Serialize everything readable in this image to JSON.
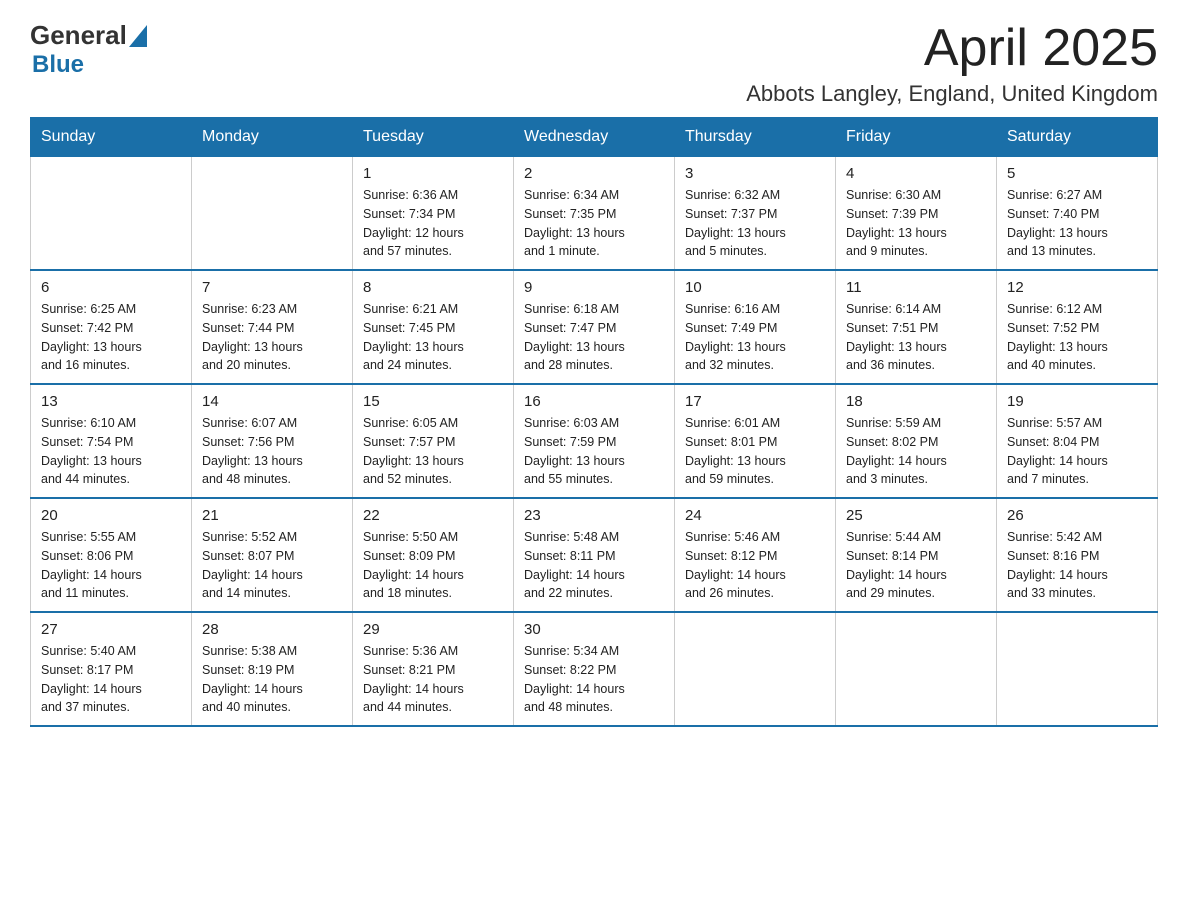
{
  "logo": {
    "text_general": "General",
    "text_blue": "Blue",
    "arrow": "▲"
  },
  "title": "April 2025",
  "location": "Abbots Langley, England, United Kingdom",
  "headers": [
    "Sunday",
    "Monday",
    "Tuesday",
    "Wednesday",
    "Thursday",
    "Friday",
    "Saturday"
  ],
  "weeks": [
    [
      {
        "day": "",
        "info": ""
      },
      {
        "day": "",
        "info": ""
      },
      {
        "day": "1",
        "info": "Sunrise: 6:36 AM\nSunset: 7:34 PM\nDaylight: 12 hours\nand 57 minutes."
      },
      {
        "day": "2",
        "info": "Sunrise: 6:34 AM\nSunset: 7:35 PM\nDaylight: 13 hours\nand 1 minute."
      },
      {
        "day": "3",
        "info": "Sunrise: 6:32 AM\nSunset: 7:37 PM\nDaylight: 13 hours\nand 5 minutes."
      },
      {
        "day": "4",
        "info": "Sunrise: 6:30 AM\nSunset: 7:39 PM\nDaylight: 13 hours\nand 9 minutes."
      },
      {
        "day": "5",
        "info": "Sunrise: 6:27 AM\nSunset: 7:40 PM\nDaylight: 13 hours\nand 13 minutes."
      }
    ],
    [
      {
        "day": "6",
        "info": "Sunrise: 6:25 AM\nSunset: 7:42 PM\nDaylight: 13 hours\nand 16 minutes."
      },
      {
        "day": "7",
        "info": "Sunrise: 6:23 AM\nSunset: 7:44 PM\nDaylight: 13 hours\nand 20 minutes."
      },
      {
        "day": "8",
        "info": "Sunrise: 6:21 AM\nSunset: 7:45 PM\nDaylight: 13 hours\nand 24 minutes."
      },
      {
        "day": "9",
        "info": "Sunrise: 6:18 AM\nSunset: 7:47 PM\nDaylight: 13 hours\nand 28 minutes."
      },
      {
        "day": "10",
        "info": "Sunrise: 6:16 AM\nSunset: 7:49 PM\nDaylight: 13 hours\nand 32 minutes."
      },
      {
        "day": "11",
        "info": "Sunrise: 6:14 AM\nSunset: 7:51 PM\nDaylight: 13 hours\nand 36 minutes."
      },
      {
        "day": "12",
        "info": "Sunrise: 6:12 AM\nSunset: 7:52 PM\nDaylight: 13 hours\nand 40 minutes."
      }
    ],
    [
      {
        "day": "13",
        "info": "Sunrise: 6:10 AM\nSunset: 7:54 PM\nDaylight: 13 hours\nand 44 minutes."
      },
      {
        "day": "14",
        "info": "Sunrise: 6:07 AM\nSunset: 7:56 PM\nDaylight: 13 hours\nand 48 minutes."
      },
      {
        "day": "15",
        "info": "Sunrise: 6:05 AM\nSunset: 7:57 PM\nDaylight: 13 hours\nand 52 minutes."
      },
      {
        "day": "16",
        "info": "Sunrise: 6:03 AM\nSunset: 7:59 PM\nDaylight: 13 hours\nand 55 minutes."
      },
      {
        "day": "17",
        "info": "Sunrise: 6:01 AM\nSunset: 8:01 PM\nDaylight: 13 hours\nand 59 minutes."
      },
      {
        "day": "18",
        "info": "Sunrise: 5:59 AM\nSunset: 8:02 PM\nDaylight: 14 hours\nand 3 minutes."
      },
      {
        "day": "19",
        "info": "Sunrise: 5:57 AM\nSunset: 8:04 PM\nDaylight: 14 hours\nand 7 minutes."
      }
    ],
    [
      {
        "day": "20",
        "info": "Sunrise: 5:55 AM\nSunset: 8:06 PM\nDaylight: 14 hours\nand 11 minutes."
      },
      {
        "day": "21",
        "info": "Sunrise: 5:52 AM\nSunset: 8:07 PM\nDaylight: 14 hours\nand 14 minutes."
      },
      {
        "day": "22",
        "info": "Sunrise: 5:50 AM\nSunset: 8:09 PM\nDaylight: 14 hours\nand 18 minutes."
      },
      {
        "day": "23",
        "info": "Sunrise: 5:48 AM\nSunset: 8:11 PM\nDaylight: 14 hours\nand 22 minutes."
      },
      {
        "day": "24",
        "info": "Sunrise: 5:46 AM\nSunset: 8:12 PM\nDaylight: 14 hours\nand 26 minutes."
      },
      {
        "day": "25",
        "info": "Sunrise: 5:44 AM\nSunset: 8:14 PM\nDaylight: 14 hours\nand 29 minutes."
      },
      {
        "day": "26",
        "info": "Sunrise: 5:42 AM\nSunset: 8:16 PM\nDaylight: 14 hours\nand 33 minutes."
      }
    ],
    [
      {
        "day": "27",
        "info": "Sunrise: 5:40 AM\nSunset: 8:17 PM\nDaylight: 14 hours\nand 37 minutes."
      },
      {
        "day": "28",
        "info": "Sunrise: 5:38 AM\nSunset: 8:19 PM\nDaylight: 14 hours\nand 40 minutes."
      },
      {
        "day": "29",
        "info": "Sunrise: 5:36 AM\nSunset: 8:21 PM\nDaylight: 14 hours\nand 44 minutes."
      },
      {
        "day": "30",
        "info": "Sunrise: 5:34 AM\nSunset: 8:22 PM\nDaylight: 14 hours\nand 48 minutes."
      },
      {
        "day": "",
        "info": ""
      },
      {
        "day": "",
        "info": ""
      },
      {
        "day": "",
        "info": ""
      }
    ]
  ]
}
